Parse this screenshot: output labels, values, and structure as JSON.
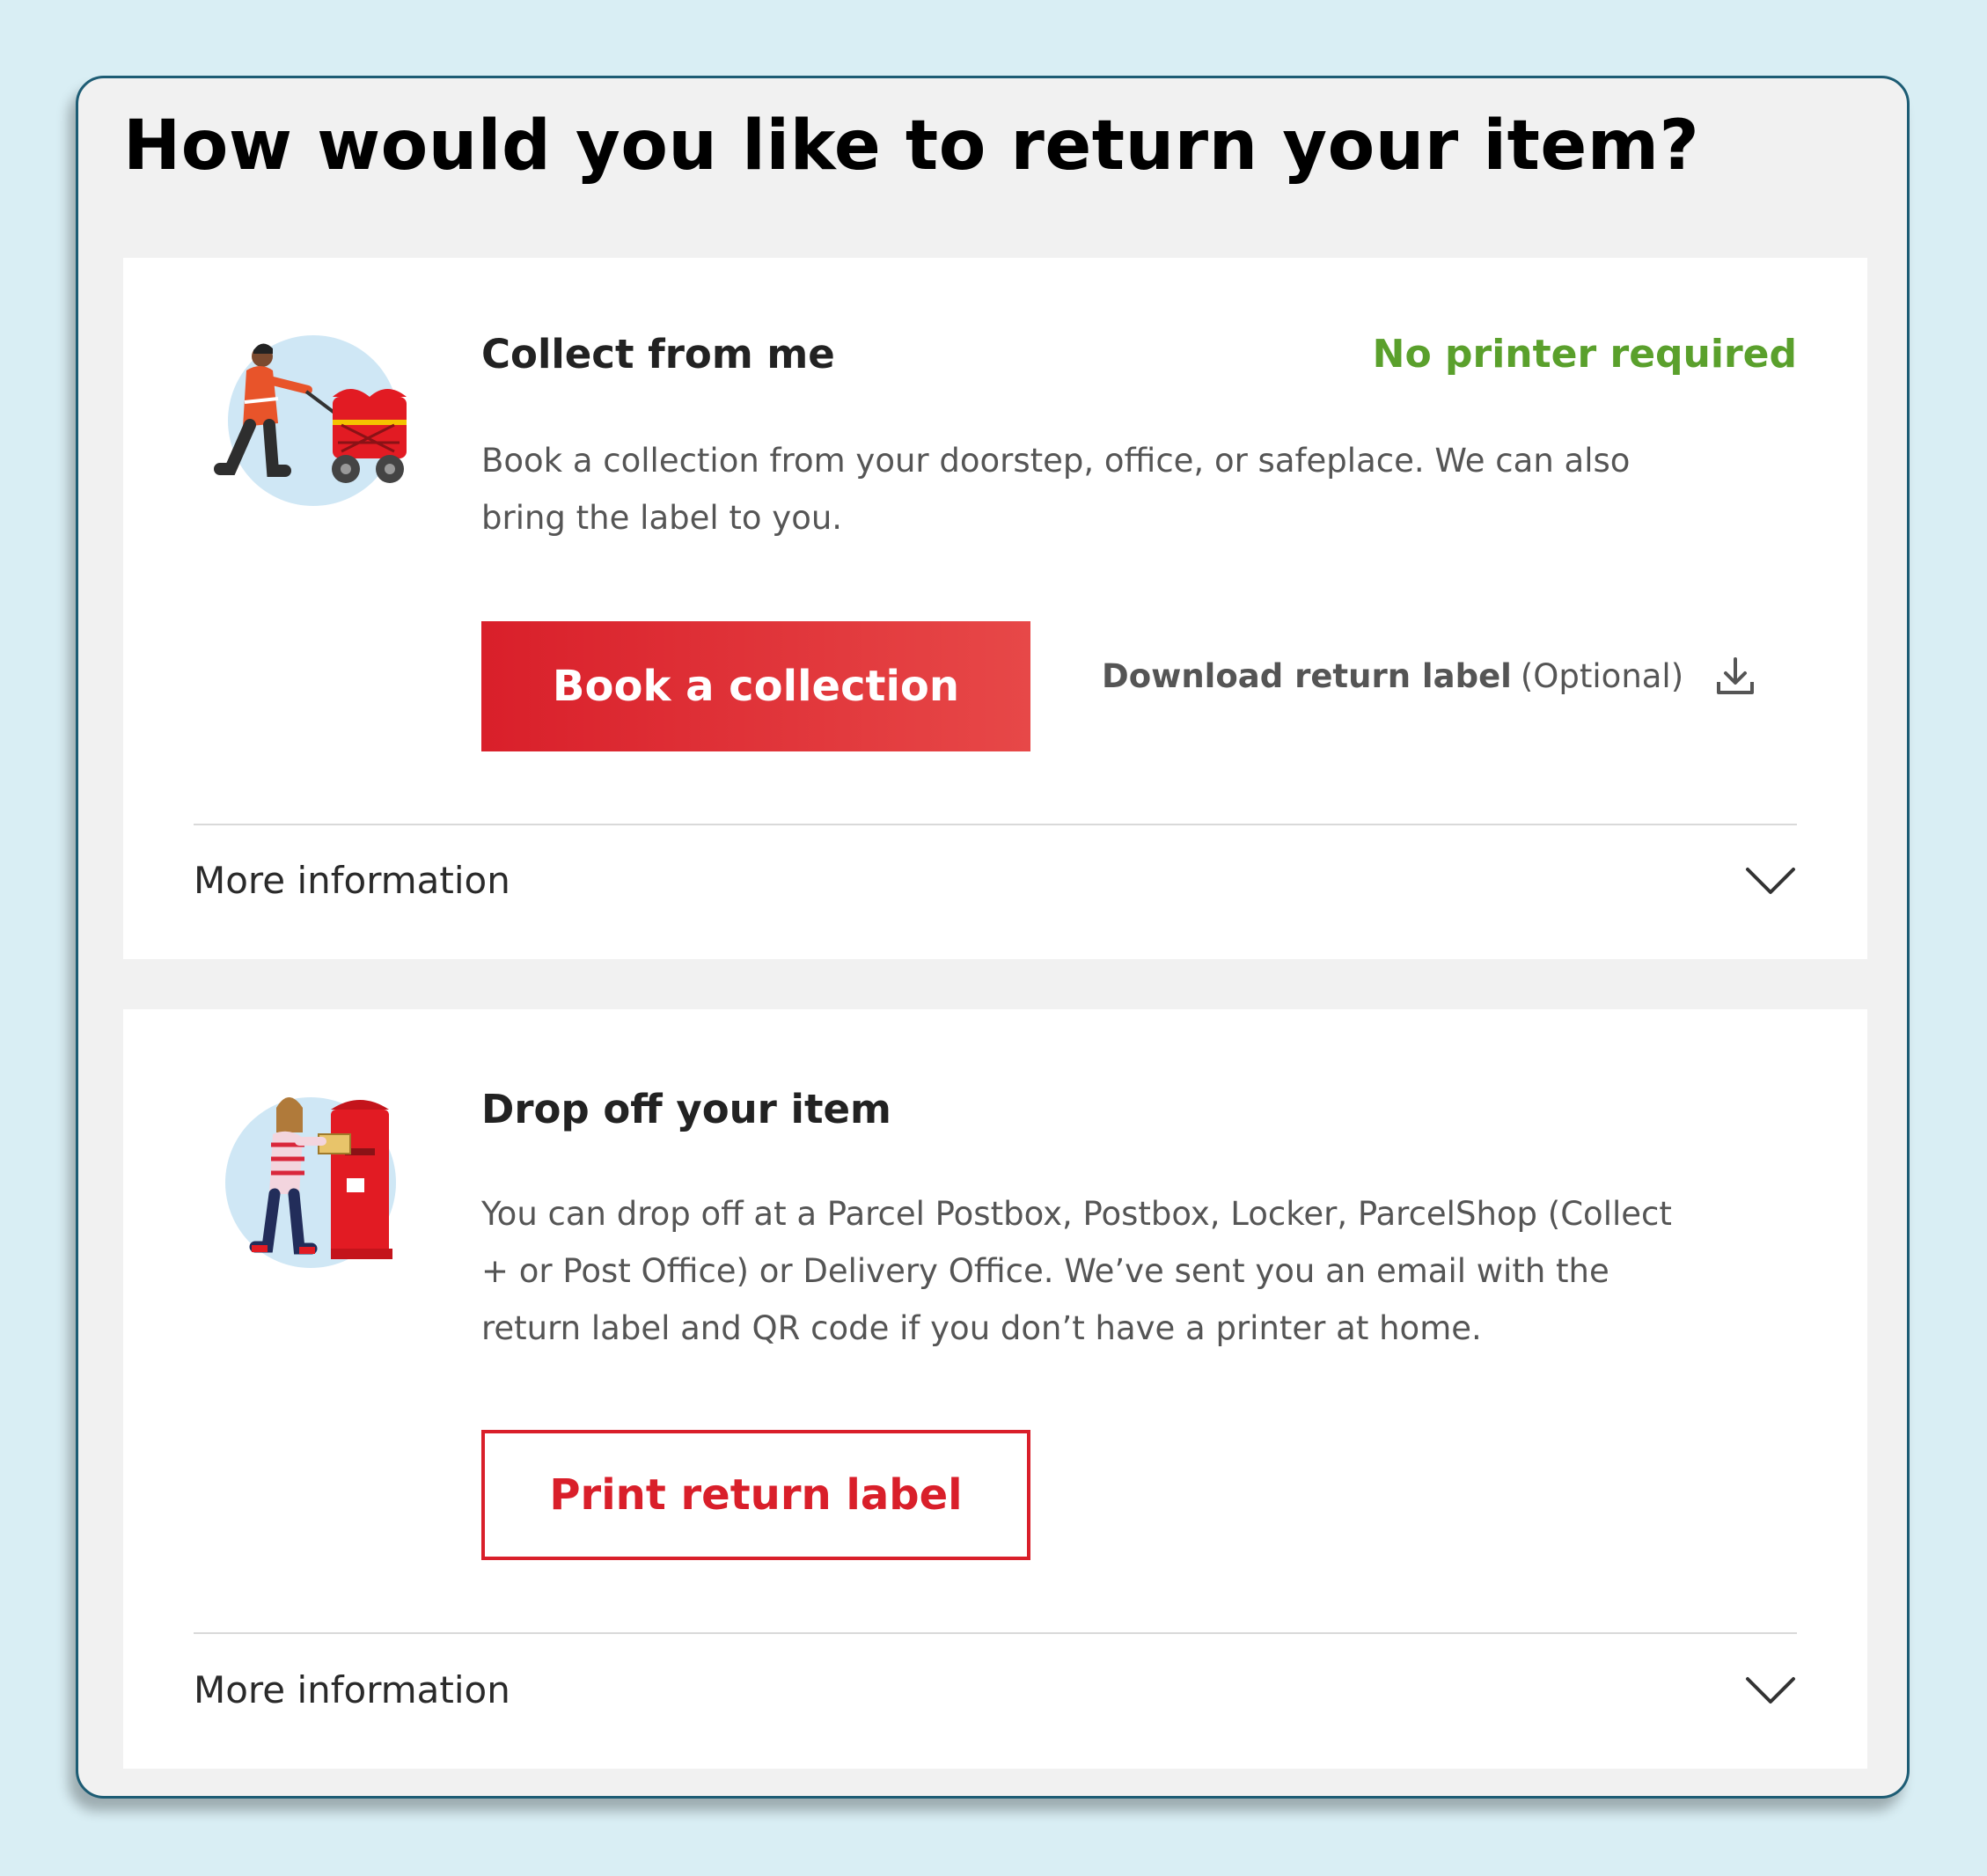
{
  "page": {
    "title": "How would you like to return your item?"
  },
  "options": [
    {
      "title": "Collect from me",
      "badge": "No printer required",
      "description": "Book a collection from your doorstep, office, or safeplace. We can also bring the label to you.",
      "primary_button": "Book a collection",
      "download_link": {
        "label": "Download return label",
        "suffix": "(Optional)",
        "icon": "download-icon"
      },
      "more_info": "More information",
      "illustration": "postal-worker-trolley-illustration"
    },
    {
      "title": "Drop off your item",
      "description": "You can drop off at a Parcel Postbox, Postbox, Locker, ParcelShop (Collect + or Post Office) or Delivery Office. We’ve sent you an email with the return label and QR code if you don’t have a printer at home.",
      "secondary_button": "Print return label",
      "more_info": "More information",
      "illustration": "woman-posting-parcel-illustration"
    }
  ],
  "colors": {
    "brand_red": "#d91f2a",
    "badge_green": "#5aa02c",
    "page_background": "#d9eef4",
    "frame_border": "#1d5c74",
    "panel_background": "#f1f1f1"
  }
}
